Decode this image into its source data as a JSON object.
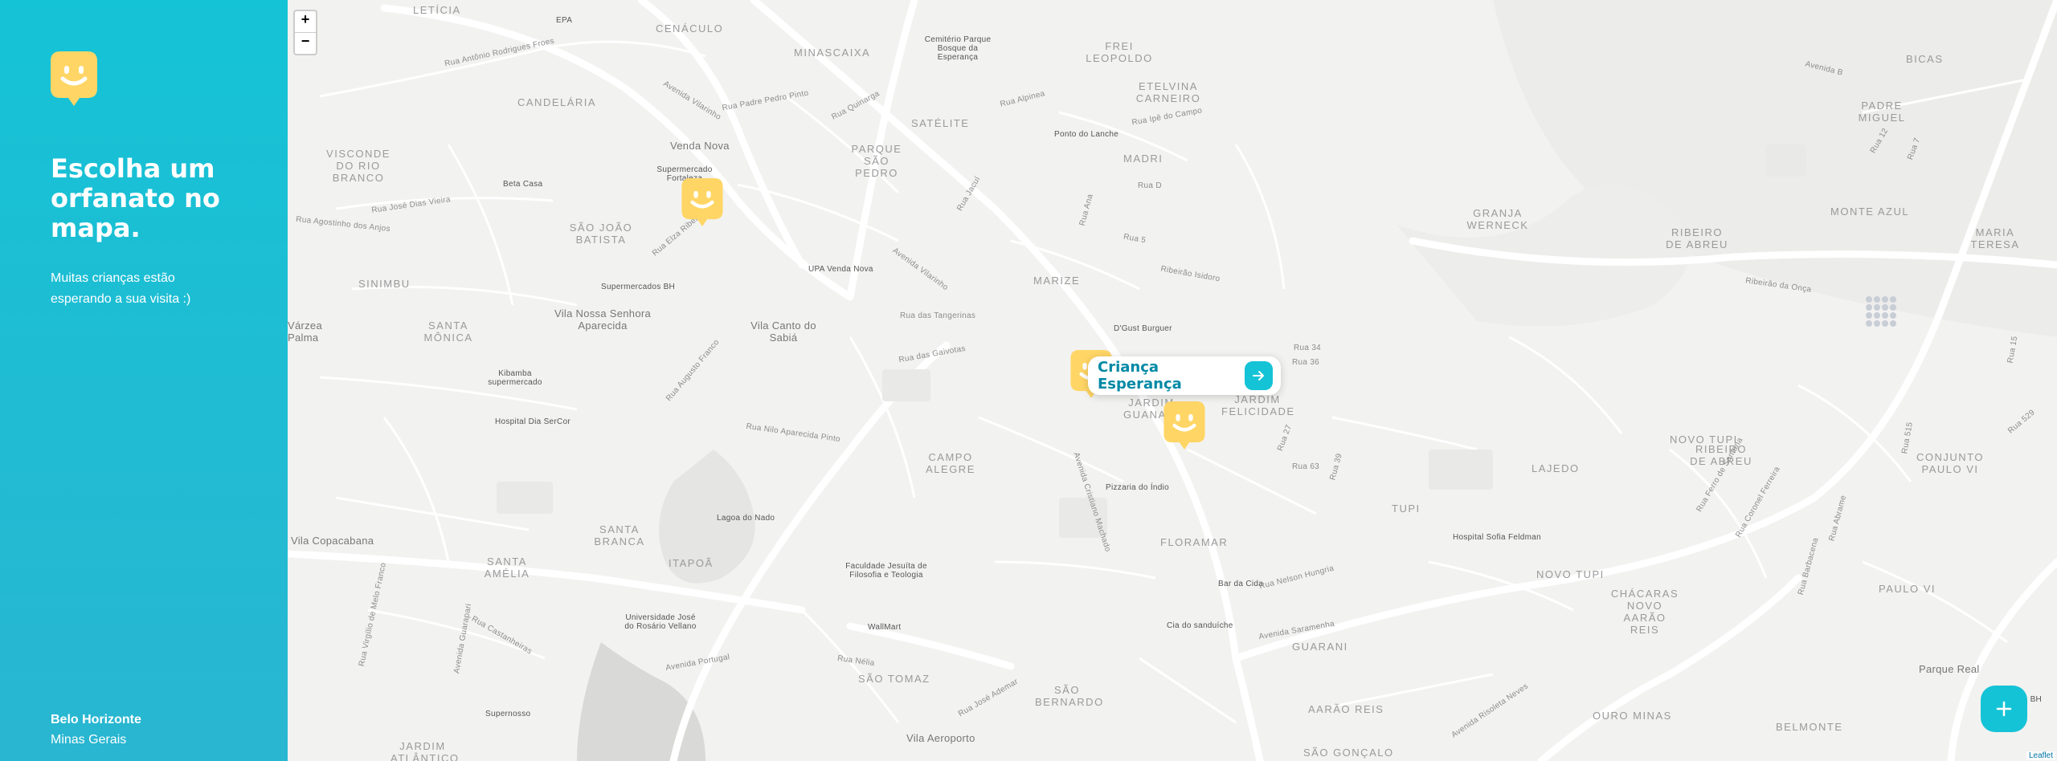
{
  "sidebar": {
    "title": "Escolha um orfanato no mapa.",
    "description": "Muitas crianças estão esperando a sua visita :)",
    "city": "Belo Horizonte",
    "state": "Minas Gerais",
    "logo_icon": "smile-marker-icon"
  },
  "map": {
    "zoom_in": "+",
    "zoom_out": "−",
    "attribution": "Leaflet",
    "popup_name": "Criança Esperança",
    "popup_icon": "arrow-right-icon",
    "fab_icon": "plus-icon",
    "districts": [
      "LETÍCIA",
      "CENÁCULO",
      "MINASCAIXA",
      "CANDELÁRIA",
      "Venda Nova",
      "PARQUE SÃO PEDRO",
      "SATÉLITE",
      "Cemitério Parque Bosque da Esperança",
      "FREI LEOPOLDO",
      "ETELVINA CARNEIRO",
      "BICAS",
      "PADRE MIGUEL",
      "MADRI",
      "VISCONDE DO RIO BRANCO",
      "SÃO JOÃO BATISTA",
      "GRANJA WERNECK",
      "RIBEIRO DE ABREU",
      "MONTE AZUL",
      "MARIA TERESA",
      "SINIMBU",
      "MARIZE",
      "Vila Nossa Senhora Aparecida",
      "Vila Canto do Sabiá",
      "SANTA MÔNICA",
      "JARDIM GUANABARA",
      "JARDIM FELICIDADE",
      "NOVO TUPI",
      "RIBEIRO DE ABREU",
      "CONJUNTO PAULO VI",
      "LAJEDO",
      "CAMPO ALEGRE",
      "TUPI",
      "SANTA BRANCA",
      "Vila Copacabana",
      "SANTA AMÉLIA",
      "ITAPOÃ",
      "FLORAMAR",
      "NOVO TUPI",
      "PAULO VI",
      "CHÁCARAS NOVO AARÃO REIS",
      "GUARANI",
      "SÃO TOMAZ",
      "SÃO BERNARDO",
      "AARÃO REIS",
      "OURO MINAS",
      "BELMONTE",
      "Parque Real",
      "Vila Aeroporto",
      "JARDIM ATLÂNTICO",
      "SÃO GONÇALO",
      "Várzea Palma"
    ],
    "pois": [
      "EPA",
      "Supermercado Fortaleza",
      "Beta Casa",
      "Supermercados BH",
      "UPA Venda Nova",
      "Ponto do Lanche",
      "D'Gust Burguer",
      "Kibamba supermercado",
      "Hospital Dia SerCor",
      "Lagoa do Nado",
      "Faculdade Jesuíta de Filosofia e Teologia",
      "Pizzaria do Índio",
      "Hospital Sofia Feldman",
      "Bar da Cida",
      "Universidade José do Rosário Vellano",
      "WallMart",
      "Cia do sanduíche",
      "Supernosso",
      "Claudo BH"
    ],
    "streets": [
      "Rua Antônio Rodrigues Froes",
      "Rua Padre Pedro Pinto",
      "Avenida Vilarinho",
      "Rua Quinarga",
      "Rua Alpinea",
      "Rua Ipê do Campo",
      "Rua Jacuí",
      "Rua D",
      "Rua 5",
      "Rua Ana",
      "Ribeirão Isidoro",
      "Rua Agostinho dos Anjos",
      "Rua José Dias Vieira",
      "Rua Elza Ribeiro",
      "Avenida Vilarinho",
      "Rua das Tangerinas",
      "Rua das Gaivotas",
      "Rua Nilo Aparecida Pinto",
      "Rua Augusto Franco",
      "Avenida Cristiano Machado",
      "Rua 34",
      "Rua 36",
      "Rua 27",
      "Rua 63",
      "Rua 39",
      "Rua Nelson Hungria",
      "Avenida Saramenha",
      "Avenida Risoleta Neves",
      "Avenida Portugal",
      "Rua Castanheiras",
      "Rua Nélia",
      "Rua José Ademar",
      "Rua Barbacena",
      "Ribeirão da Onça",
      "Rua Ferro de Santana",
      "Rua Coronel Ferreira",
      "Rua Abrame",
      "Avenida B",
      "Rua 12",
      "Rua 7",
      "Rua 15",
      "Rua 529",
      "Rua 515",
      "Avenida Guarapari",
      "Rua Virgílio de Melo Franco"
    ]
  }
}
